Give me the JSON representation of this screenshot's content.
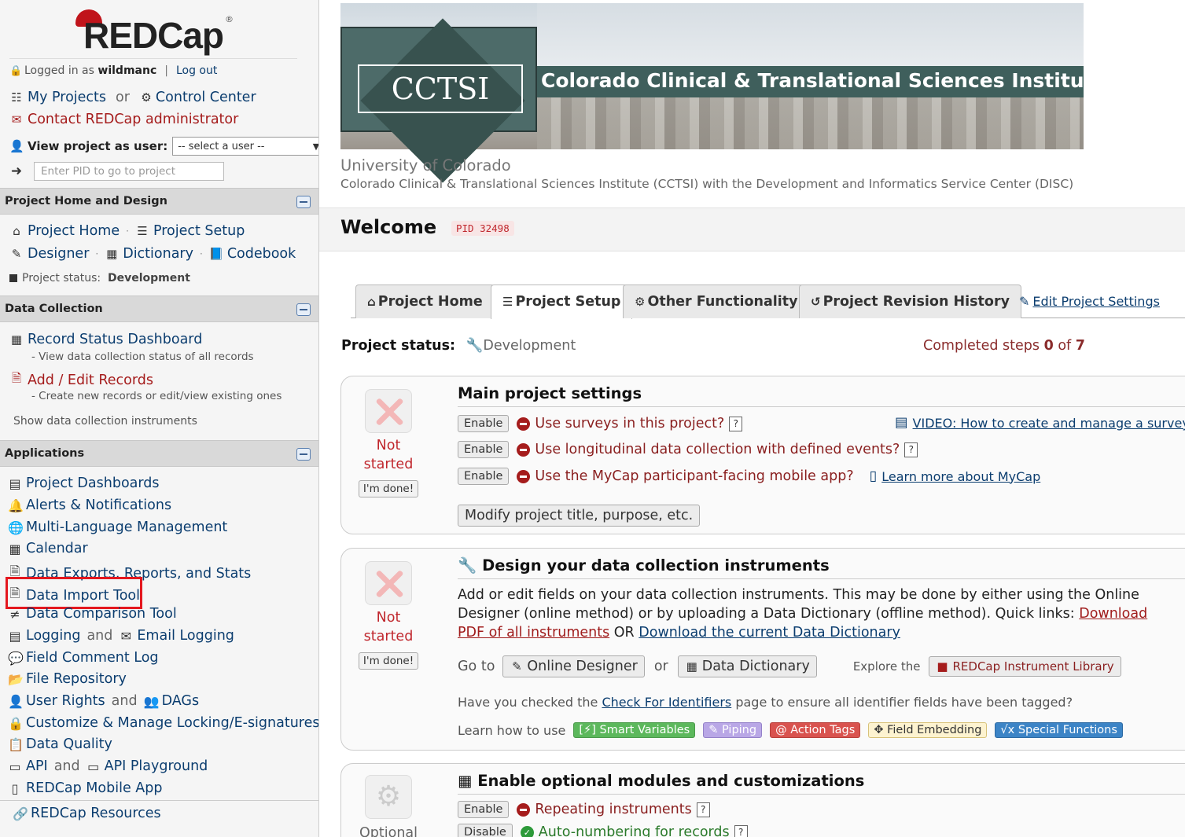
{
  "logo": {
    "text": "REDCap",
    "reg": "®"
  },
  "user": {
    "logged_in_prefix": "Logged in as",
    "username": "wildmanc",
    "logout": "Log out"
  },
  "nav": {
    "my_projects": "My Projects",
    "or": "or",
    "control_center": "Control Center",
    "contact": "Contact REDCap administrator"
  },
  "view_as": {
    "label": "View project as user:",
    "selected": "-- select a user --"
  },
  "pid_input": {
    "placeholder": "Enter PID to go to project"
  },
  "sections": {
    "home_design": {
      "title": "Project Home and Design",
      "project_home": "Project Home",
      "project_setup": "Project Setup",
      "designer": "Designer",
      "dictionary": "Dictionary",
      "codebook": "Codebook",
      "status_label": "Project status:",
      "status_value": "Development"
    },
    "data_collection": {
      "title": "Data Collection",
      "record_status": "Record Status Dashboard",
      "record_status_desc": "- View data collection status of all records",
      "add_edit": "Add / Edit Records",
      "add_edit_desc": "- Create new records or edit/view existing ones",
      "show_instruments": "Show data collection instruments"
    },
    "applications": {
      "title": "Applications",
      "items": {
        "dashboards": "Project Dashboards",
        "alerts": "Alerts & Notifications",
        "mlm": "Multi-Language Management",
        "calendar": "Calendar",
        "exports": "Data Exports, Reports, and Stats",
        "import": "Data Import Tool",
        "compare": "Data Comparison Tool",
        "logging": "Logging",
        "email_logging": "Email Logging",
        "comment_log": "Field Comment Log",
        "file_repo": "File Repository",
        "user_rights": "User Rights",
        "dags": "DAGs",
        "locking": "Customize & Manage Locking/E-signatures",
        "quality": "Data Quality",
        "api": "API",
        "api_playground": "API Playground",
        "mobile": "REDCap Mobile App",
        "and": "and"
      }
    },
    "resources": "REDCap Resources"
  },
  "banner": {
    "short": "CCTSI",
    "long": "Colorado Clinical & Translational Sciences Institute"
  },
  "header": {
    "university": "University of Colorado",
    "institute": "Colorado Clinical & Translational Sciences Institute (CCTSI) with the Development and Informatics Service Center (DISC)",
    "welcome": "Welcome",
    "pid": "PID 32498"
  },
  "tabs": {
    "project_home": "Project Home",
    "project_setup": "Project Setup",
    "other": "Other Functionality",
    "revision": "Project Revision History",
    "edit_settings": "Edit Project Settings"
  },
  "status": {
    "label": "Project status:",
    "value": "Development",
    "steps_prefix": "Completed steps",
    "steps_done": "0",
    "steps_of": "of",
    "steps_total": "7"
  },
  "common": {
    "not": "Not",
    "started": "started",
    "im_done": "I'm done!",
    "enable": "Enable",
    "disable": "Disable",
    "optional": "Optional"
  },
  "card1": {
    "title": "Main project settings",
    "surveys": "Use surveys in this project?",
    "video": "VIDEO: How to create and manage a survey",
    "longitudinal": "Use longitudinal data collection with defined events?",
    "mycap": "Use the MyCap participant-facing mobile app?",
    "mycap_link": "Learn more about MyCap",
    "modify": "Modify project title, purpose, etc.",
    "qm": "?"
  },
  "card2": {
    "title": "Design your data collection instruments",
    "text1": "Add or edit fields on your data collection instruments. This may be done by either using the Online Designer (online method) or by uploading a Data Dictionary (offline method). Quick links:",
    "link_pdf": "Download PDF of all instruments",
    "or": "OR",
    "link_dd": "Download the current Data Dictionary",
    "goto": "Go to",
    "online_designer": "Online Designer",
    "or2": "or",
    "data_dictionary": "Data Dictionary",
    "explore": "Explore the",
    "library": "REDCap Instrument Library",
    "check_prefix": "Have you checked the",
    "check_link": "Check For Identifiers",
    "check_suffix": "page to ensure all identifier fields have been tagged?",
    "learn": "Learn how to use",
    "tags": {
      "smart": "Smart Variables",
      "piping": "Piping",
      "action": "Action Tags",
      "embed": "Field Embedding",
      "special": "Special Functions"
    }
  },
  "card3": {
    "title": "Enable optional modules and customizations",
    "repeating": "Repeating instruments",
    "autonumber": "Auto-numbering for records"
  },
  "colors": {
    "accent_red": "#a51c1c",
    "link_blue": "#0b3d6f",
    "highlight": "#e4171e"
  }
}
